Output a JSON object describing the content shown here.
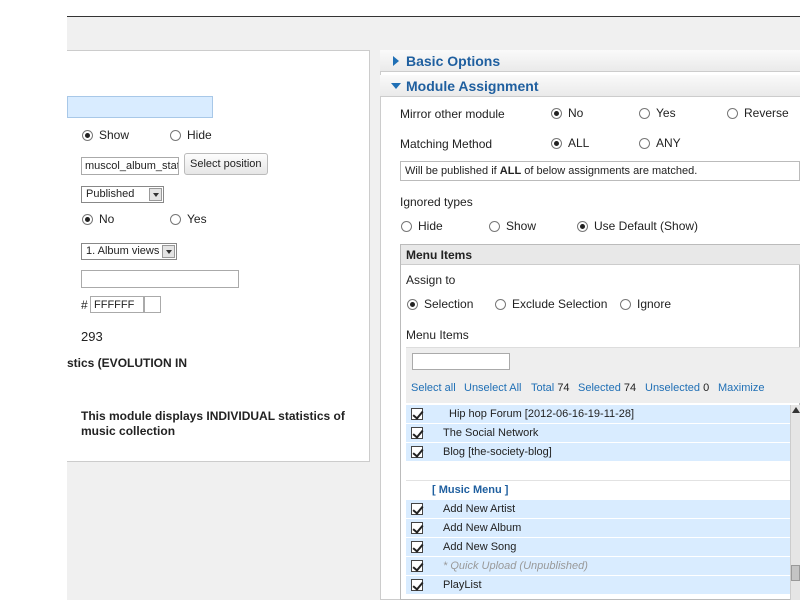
{
  "left": {
    "show_hide": {
      "show": "Show",
      "hide": "Hide",
      "selected": "Show"
    },
    "position": {
      "value": "muscol_album_stats",
      "button": "Select position"
    },
    "status": {
      "value": "Published"
    },
    "yes_no": {
      "no": "No",
      "yes": "Yes",
      "selected": "No"
    },
    "album_views": {
      "value": "1. Album views"
    },
    "color": {
      "hash": "#",
      "value": "FFFFFF"
    },
    "id_value": "293",
    "module_name_fragment": "stics (EVOLUTION IN",
    "description": "This module displays INDIVIDUAL statistics of music collection"
  },
  "right": {
    "accordion": [
      {
        "title": "Basic Options",
        "expanded": false
      },
      {
        "title": "Module Assignment",
        "expanded": true
      }
    ],
    "mirror": {
      "label": "Mirror other module",
      "options": [
        "No",
        "Yes",
        "Reverse"
      ],
      "selected": "No"
    },
    "matching": {
      "label": "Matching Method",
      "options": [
        "ALL",
        "ANY"
      ],
      "selected": "ALL"
    },
    "info": {
      "pre": "Will be published if ",
      "bold": "ALL",
      "post": " of below assignments are matched."
    },
    "ignored": {
      "label": "Ignored types",
      "options": [
        "Hide",
        "Show",
        "Use Default (Show)"
      ],
      "selected": "Use Default (Show)"
    },
    "menu_items": {
      "header": "Menu Items",
      "assign_label": "Assign to",
      "assign_options": [
        "Selection",
        "Exclude Selection",
        "Ignore"
      ],
      "assign_selected": "Selection",
      "list_label": "Menu Items",
      "toolbar": {
        "select_all": "Select all",
        "unselect_all": "Unselect All",
        "total_label": "Total",
        "total": "74",
        "selected_label": "Selected",
        "selected": "74",
        "unselected_label": "Unselected",
        "unselected": "0",
        "maximize": "Maximize"
      },
      "rows": [
        {
          "kind": "item",
          "checked": true,
          "text": "Hip hop Forum [2012-06-16-19-11-28]",
          "indent": 2
        },
        {
          "kind": "item",
          "checked": true,
          "text": "The Social Network",
          "indent": 1
        },
        {
          "kind": "item",
          "checked": true,
          "text": "Blog [the-society-blog]",
          "indent": 1
        },
        {
          "kind": "blank",
          "text": ""
        },
        {
          "kind": "header",
          "text": "[ Music Menu ]"
        },
        {
          "kind": "item",
          "checked": true,
          "text": "Add New Artist",
          "indent": 1
        },
        {
          "kind": "item",
          "checked": true,
          "text": "Add New Album",
          "indent": 1
        },
        {
          "kind": "item",
          "checked": true,
          "text": "Add New Song",
          "indent": 1
        },
        {
          "kind": "item",
          "checked": true,
          "text": "*    Quick Upload (Unpublished)",
          "indent": 1,
          "muted": true
        },
        {
          "kind": "item",
          "checked": true,
          "text": "PlayList",
          "indent": 1
        }
      ]
    }
  }
}
